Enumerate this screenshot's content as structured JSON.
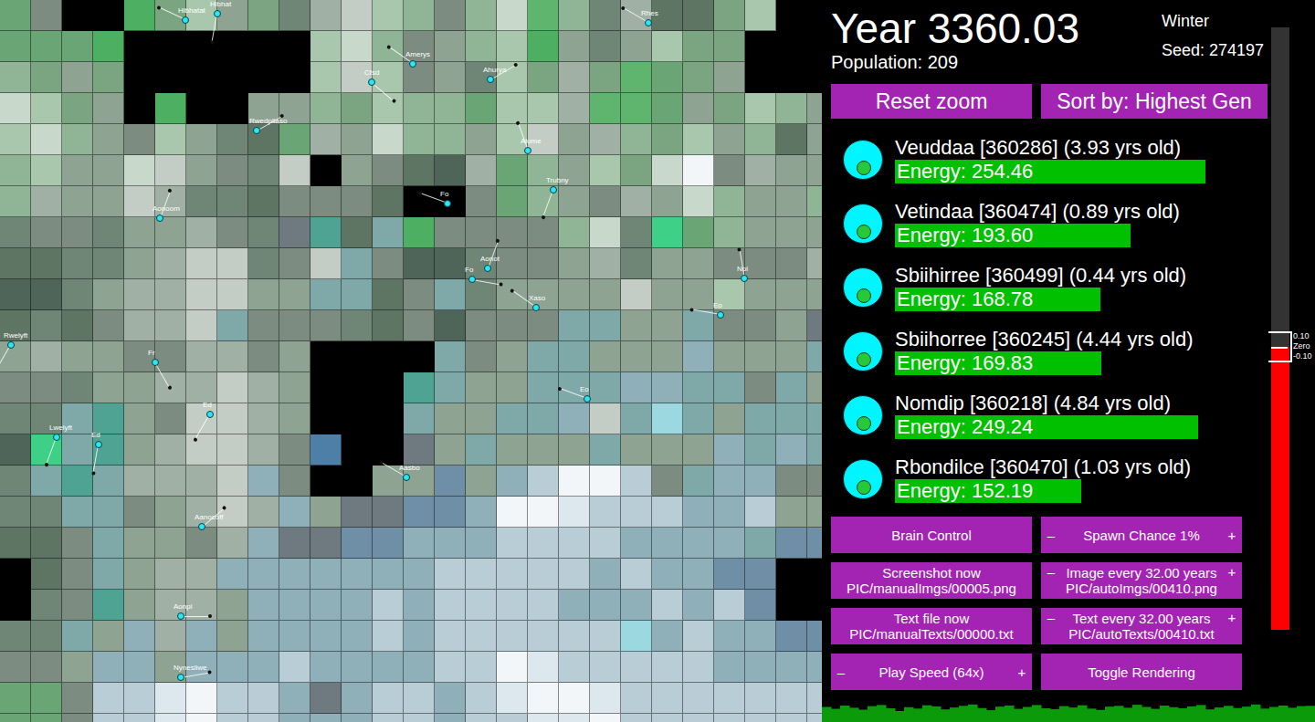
{
  "map": {
    "palette": {
      "k": "#000000",
      "g": "#4caf61",
      "h": "#5fb46e",
      "m": "#6aa576",
      "n": "#7aa580",
      "o": "#8fb596",
      "p": "#a9c7ad",
      "q": "#c8d8cb",
      "r": "#5f7564",
      "s": "#6f8575",
      "t": "#7d8c80",
      "u": "#8fa392",
      "v": "#a0b0a4",
      "w": "#c3cdc6",
      "x": "#4f655a",
      "y": "#4fa392",
      "z": "#3fd087",
      "c": "#7fa8a8",
      "d": "#8fb0b8",
      "e": "#6f8fa6",
      "f": "#4e7fa6",
      "i": "#b9cdd6",
      "j": "#dce8ee",
      "l": "#f2f6f8",
      "b": "#9bd8e0",
      "a": "#6e7a80"
    },
    "rows": [
      "mtkkgnpunsvwpotoqhosvrrnpkk",
      "mmmgkkkkkkpqotuopgusupnnkkk",
      "onunkkkkkkpwptuspnvnhmnukkk",
      "qpnukgkkuuonpoomppvhhmunpou",
      "pqoutpusrmvuqooupwuvonpuoru",
      "opuuqwutswkutrxvmoupnqltvuu",
      "ovuuwvssrtttrkktmoutvuqouuo",
      "sttsuuvtsayrcgttttoqszmouuu",
      "rrssuvwwstwctxxsttuvsuutttv",
      "xxsuvvwwuuccrtcsuuuuwuupuuu",
      "rsrtvvwctttsrtxtttccuucttua",
      "uvuuttvvtukkkkctuccuuuduuuc",
      "ttsuuvvwvukkkycuucccddcctcu",
      "sscyutwwvukkkcuuccdwcbcuccc",
      "xzcyuvwwvtfkkaucuuucuuudcdc",
      "scycvvvwdtkkuueudillitcddtt",
      "sscctuvwvduaaeedlljiiiddiuu",
      "rrtcuutvdaaeedddiiiiddddcee",
      "krtcuvvdddddddiiiiididdeekk",
      "kstyuvvuddddidiiiidddidiekk",
      "sscudvduddddidiiiiiibdiddee",
      "ttuddudddiddddiiljiiiiidddd",
      "mmtiijliidadiidijlljiiiiiii",
      "mmtiijliidddiidiijjliiiiiii"
    ],
    "creatures": [
      {
        "name": "Hibhatat"
      },
      {
        "name": "Hibhat"
      },
      {
        "name": "Amerys"
      },
      {
        "name": "Cfsd"
      },
      {
        "name": "Ahurya"
      },
      {
        "name": "Rhes"
      },
      {
        "name": "Rwedpliaso"
      },
      {
        "name": "Alume"
      },
      {
        "name": "Aonoom"
      },
      {
        "name": "Trubny"
      },
      {
        "name": "Fo"
      },
      {
        "name": "Aonot"
      },
      {
        "name": "Fo"
      },
      {
        "name": "Xaso"
      },
      {
        "name": "Noi"
      },
      {
        "name": "Eo"
      },
      {
        "name": "Fr"
      },
      {
        "name": "Eo"
      },
      {
        "name": "Ed"
      },
      {
        "name": "Lwelyft"
      },
      {
        "name": "Ed"
      },
      {
        "name": "Aasbo"
      },
      {
        "name": "Aanocoff"
      },
      {
        "name": "Aonpi"
      },
      {
        "name": "Nynesliwe"
      },
      {
        "name": "Rwelyft"
      }
    ]
  },
  "header": {
    "year": "Year 3360.03",
    "season": "Winter",
    "seed": "Seed: 274197",
    "population": "Population: 209"
  },
  "top_buttons": [
    "Reset zoom",
    "Sort by: Highest Gen"
  ],
  "creature_list": [
    {
      "label": "Veuddaa [360286] (3.93 yrs old)",
      "energy": "Energy: 254.46",
      "level": 0.85
    },
    {
      "label": "Vetindaa [360474] (0.89 yrs old)",
      "energy": "Energy: 193.60",
      "level": 0.645
    },
    {
      "label": "Sbiihirree [360499] (0.44 yrs old)",
      "energy": "Energy: 168.78",
      "level": 0.5625
    },
    {
      "label": "Sbiihorree [360245] (4.44 yrs old)",
      "energy": "Energy: 169.83",
      "level": 0.565
    },
    {
      "label": "Nomdip [360218] (4.84 yrs old)",
      "energy": "Energy: 249.24",
      "level": 0.83
    },
    {
      "label": "Rbondilce [360470] (1.03 yrs old)",
      "energy": "Energy: 152.19",
      "level": 0.51
    }
  ],
  "meter": {
    "level": 0.47,
    "labels": [
      "0.10",
      "Zero",
      "-0.10"
    ]
  },
  "controls": [
    {
      "kind": "plain",
      "lines": [
        "Brain Control"
      ]
    },
    {
      "kind": "stepper",
      "minus": "–",
      "plus": "+",
      "lines": [
        "Spawn Chance 1%"
      ]
    },
    {
      "kind": "plain",
      "lines": [
        "Screenshot now",
        "PIC/manualImgs/00005.png"
      ]
    },
    {
      "kind": "stepper",
      "minus": "–",
      "plus": "+",
      "lines": [
        "Image every 32.00 years",
        "PIC/autoImgs/00410.png"
      ]
    },
    {
      "kind": "plain",
      "lines": [
        "Text file now",
        "PIC/manualTexts/00000.txt"
      ]
    },
    {
      "kind": "stepper",
      "minus": "–",
      "plus": "+",
      "lines": [
        "Text every 32.00 years",
        "PIC/autoTexts/00410.txt"
      ]
    },
    {
      "kind": "stepper",
      "minus": "–",
      "plus": "+",
      "lines": [
        "Play Speed (64x)"
      ]
    },
    {
      "kind": "plain",
      "lines": [
        "Toggle Rendering"
      ]
    }
  ],
  "population_chart": {
    "values": [
      205,
      198,
      210,
      202,
      195,
      208,
      212,
      200,
      190,
      204,
      199,
      211,
      207,
      196,
      203,
      209,
      214,
      201,
      193,
      206,
      210,
      198,
      205,
      212,
      200,
      197,
      208,
      203,
      211,
      199,
      194,
      206,
      209,
      202,
      213,
      205,
      198,
      210,
      204,
      200,
      207,
      212,
      196,
      203,
      209,
      201,
      206,
      214,
      199,
      205,
      210,
      202,
      208,
      209
    ]
  }
}
